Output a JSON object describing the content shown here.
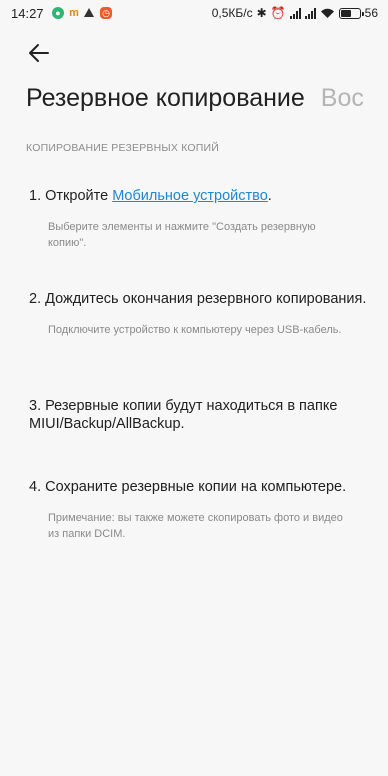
{
  "status_bar": {
    "time": "14:27",
    "speed": "0,5КБ/с",
    "battery": "56",
    "battery_level": 0.56,
    "icons": [
      "app-green-icon",
      "app-m-icon",
      "app-triangle-icon",
      "app-clock-icon",
      "bluetooth-icon",
      "alarm-icon",
      "signal-icon",
      "signal-icon",
      "wifi-icon",
      "battery-icon"
    ]
  },
  "tabs": [
    "Резервное копирование",
    "Вос"
  ],
  "section_header": "КОПИРОВАНИЕ РЕЗЕРВНЫХ КОПИЙ",
  "steps": [
    {
      "prefix": "1. Откройте ",
      "link": "Мобильное устройство",
      "suffix": ".",
      "desc": "Выберите элементы и нажмите \"Создать резервную копию\"."
    },
    {
      "title": "2. Дождитесь окончания резервного копирования.",
      "desc": "Подключите устройство к компьютеру через USB-кабель."
    },
    {
      "title": "3. Резервные копии будут находиться в папке MIUI/Backup/AllBackup."
    },
    {
      "title": "4. Сохраните резервные копии на компьютере.",
      "desc": "Примечание: вы также можете скопировать фото и видео из папки DCIM."
    }
  ],
  "colors": {
    "link": "#1e87d6",
    "background": "#f7f7f7"
  }
}
